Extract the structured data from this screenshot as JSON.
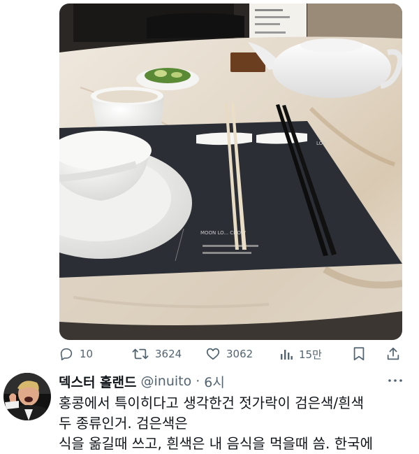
{
  "photo": {
    "placemat_restaurant_name": "MOON LO... CHOW",
    "placemat_brand": "LOK"
  },
  "actions": {
    "replies": "10",
    "retweets": "3624",
    "likes": "3062",
    "views": "15만"
  },
  "tweet": {
    "display_name": "덱스터 홀랜드",
    "handle": "@inuito",
    "separator": "·",
    "time": "6시",
    "lines": [
      "홍콩에서 특이히다고 생각한건 젓가락이 검은색/흰색",
      "두 종류인거. 검은색은",
      "식을 옮길때 쓰고, 흰색은 내 음식을 먹을때 씀. 한국에"
    ]
  },
  "icons": {
    "reply": "reply-icon",
    "retweet": "retweet-icon",
    "like": "heart-icon",
    "views": "views-icon",
    "bookmark": "bookmark-icon",
    "share": "share-icon",
    "more": "more-icon"
  },
  "colors": {
    "text_primary": "#0f1419",
    "text_secondary": "#536471",
    "placemat": "#2b2f35"
  }
}
